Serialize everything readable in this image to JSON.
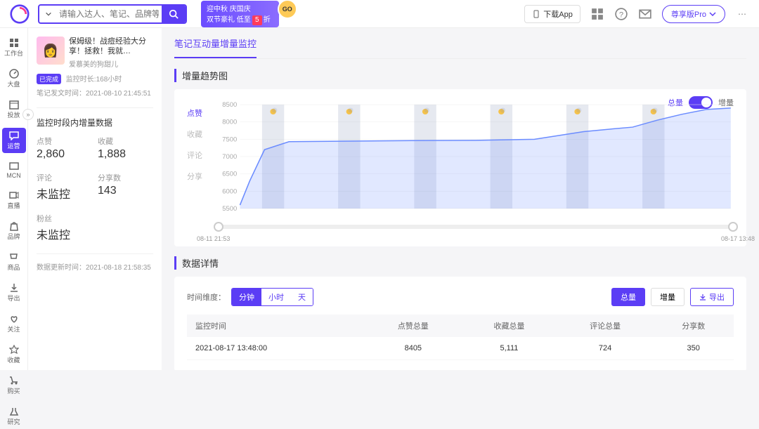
{
  "header": {
    "search_placeholder": "请输入达人、笔记、品牌等搜索",
    "download_label": "下载App",
    "pro_label": "尊享版Pro",
    "promo_line1": "迎中秋 庆国庆",
    "promo_line2_a": "双节豪礼 低至",
    "promo_five": "5",
    "promo_line2_b": "折",
    "promo_go": "GO"
  },
  "leftnav": [
    {
      "label": "工作台",
      "icon": "grid"
    },
    {
      "label": "大盘",
      "icon": "dashboard"
    },
    {
      "label": "投放",
      "icon": "calendar"
    },
    {
      "label": "运营",
      "icon": "chat"
    },
    {
      "label": "MCN",
      "icon": "screen"
    },
    {
      "label": "直播",
      "icon": "video"
    },
    {
      "label": "品牌",
      "icon": "bag"
    },
    {
      "label": "商品",
      "icon": "cart"
    },
    {
      "label": "导出",
      "icon": "download"
    },
    {
      "label": "关注",
      "icon": "heart"
    },
    {
      "label": "收藏",
      "icon": "star"
    },
    {
      "label": "购买",
      "icon": "shop"
    },
    {
      "label": "研究",
      "icon": "flask"
    }
  ],
  "note": {
    "title": "保姆级！战痘经验大分享！拯救！我就…",
    "author": "爱慕美的狗甜儿",
    "badge": "已完成",
    "monitor_dur_label": "监控时长",
    "monitor_dur": "168小时",
    "pub_label": "笔记发文时间",
    "pub_time": "2021-08-10 21:45:51"
  },
  "stats": {
    "section_title": "监控时段内增量数据",
    "items": {
      "likes": {
        "label": "点赞",
        "value": "2,860"
      },
      "favs": {
        "label": "收藏",
        "value": "1,888"
      },
      "comments": {
        "label": "评论",
        "value": "未监控"
      },
      "shares": {
        "label": "分享数",
        "value": "143"
      },
      "fans": {
        "label": "粉丝",
        "value": "未监控"
      }
    },
    "refresh_label": "数据更新时间",
    "refresh_time": "2021-08-18 21:58:35"
  },
  "tabs": {
    "active": "笔记互动量增量监控"
  },
  "trend": {
    "title": "增量趋势图",
    "toggle_left": "总量",
    "toggle_right": "增量",
    "metrics": [
      "点赞",
      "收藏",
      "评论",
      "分享"
    ],
    "slider_start": "08-11 21:53",
    "slider_end": "08-17 13:48"
  },
  "chart_data": {
    "type": "line",
    "xlabel": "",
    "ylabel": "",
    "ylim": [
      5500,
      8500
    ],
    "yticks": [
      5500,
      6000,
      6500,
      7000,
      7500,
      8000,
      8500
    ],
    "x_range": [
      "08-11 21:53",
      "08-17 13:48"
    ],
    "series": [
      {
        "name": "点赞",
        "x_rel": [
          0,
          0.02,
          0.04,
          0.05,
          0.1,
          0.35,
          0.48,
          0.6,
          0.7,
          0.76,
          0.8,
          0.85,
          0.9,
          0.95,
          1.0
        ],
        "values": [
          5600,
          6300,
          6900,
          7200,
          7430,
          7460,
          7470,
          7500,
          7720,
          7800,
          7850,
          8050,
          8220,
          8360,
          8400
        ]
      }
    ],
    "night_bands_rel": [
      [
        0.045,
        0.09
      ],
      [
        0.2,
        0.245
      ],
      [
        0.355,
        0.4
      ],
      [
        0.51,
        0.555
      ],
      [
        0.665,
        0.71
      ],
      [
        0.82,
        0.865
      ]
    ]
  },
  "detail": {
    "title": "数据详情",
    "gran_label": "时间维度：",
    "gran_options": [
      "分钟",
      "小时",
      "天"
    ],
    "view_total": "总量",
    "view_delta": "增量",
    "export_label": "导出",
    "columns": [
      "监控时间",
      "点赞总量",
      "收藏总量",
      "评论总量",
      "分享数"
    ],
    "rows": [
      {
        "time": "2021-08-17 13:48:00",
        "likes": "8405",
        "favs": "5,111",
        "comments": "724",
        "shares": "350"
      }
    ]
  }
}
